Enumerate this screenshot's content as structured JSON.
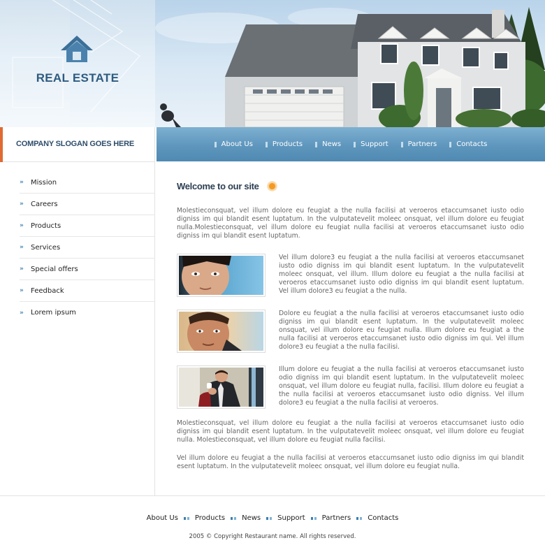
{
  "header": {
    "logo_text": "REAL ESTATE",
    "slogan": "COMPANY SLOGAN GOES HERE"
  },
  "top_nav": [
    {
      "label": "About Us"
    },
    {
      "label": "Products"
    },
    {
      "label": "News"
    },
    {
      "label": "Support"
    },
    {
      "label": "Partners"
    },
    {
      "label": "Contacts"
    }
  ],
  "sidebar": {
    "items": [
      {
        "label": "Mission"
      },
      {
        "label": "Careers"
      },
      {
        "label": "Products"
      },
      {
        "label": "Services"
      },
      {
        "label": "Special offers"
      },
      {
        "label": "Feedback"
      },
      {
        "label": "Lorem ipsum"
      }
    ]
  },
  "main": {
    "title": "Welcome to our site",
    "intro": "Molestieconsquat, vel illum dolore eu feugiat a the nulla facilisi at veroeros etaccumsanet iusto odio digniss im qui blandit esent luptatum. In the vulputatevelit moleec onsquat, vel illum dolore eu feugiat nulla.Molestieconsquat, vel illum dolore eu feugiat nulla facilisi at veroeros etaccumsanet iusto odio digniss im qui blandit esent luptatum.",
    "people": [
      {
        "text": "Vel illum dolore3 eu feugiat a the nulla facilisi at veroeros etaccumsanet iusto odio digniss im qui blandit esent luptatum. In the vulputatevelit moleec onsquat, vel illum. Illum dolore eu feugiat a the nulla facilisi at veroeros etaccumsanet iusto odio digniss im qui blandit esent luptatum. Vel illum dolore3 eu feugiat a the nulla."
      },
      {
        "text": "Dolore eu feugiat a the nulla facilisi at veroeros etaccumsanet iusto odio digniss im qui blandit esent luptatum. In the vulputatevelit moleec onsquat, vel illum dolore eu feugiat nulla. Illum dolore eu feugiat a the nulla facilisi at veroeros etaccumsanet iusto odio digniss im qui. Vel illum dolore3 eu feugiat a the nulla facilisi."
      },
      {
        "text": "Illum dolore eu feugiat a the nulla facilisi at veroeros etaccumsanet iusto odio digniss im qui blandit esent luptatum. In the vulputatevelit moleec onsquat, vel illum dolore eu feugiat nulla, facilisi. Illum dolore eu feugiat a the nulla facilisi at veroeros etaccumsanet iusto odio digniss. Vel illum dolore3 eu feugiat a the nulla facilisi at veroeros."
      }
    ],
    "para2": "Molestieconsquat, vel illum dolore eu feugiat a the nulla facilisi at veroeros etaccumsanet iusto odio digniss im qui blandit esent luptatum. In the vulputatevelit moleec onsquat, vel illum dolore eu feugiat nulla. Molestieconsquat, vel illum dolore eu feugiat nulla facilisi.",
    "para3": "Vel illum dolore eu feugiat a the nulla facilisi at veroeros etaccumsanet iusto odio digniss im qui blandit esent luptatum. In the vulputatevelit moleec onsquat, vel illum dolore eu feugiat nulla."
  },
  "footer": {
    "links": [
      {
        "label": "About Us"
      },
      {
        "label": "Products"
      },
      {
        "label": "News"
      },
      {
        "label": "Support"
      },
      {
        "label": "Partners"
      },
      {
        "label": "Contacts"
      }
    ],
    "copyright": "2005 © Copyright Restaurant name. All rights reserved."
  },
  "colors": {
    "brand_blue": "#2e5b80",
    "nav_blue": "#5e96bd",
    "accent_orange": "#e06a34",
    "bullet_orange": "#f39a22"
  },
  "icons": {
    "logo": "house-icon",
    "sidebar_bullet": "double-chevron-right-icon",
    "nav_marker": "bar-marker-icon",
    "title_marker": "orange-dot-icon"
  }
}
